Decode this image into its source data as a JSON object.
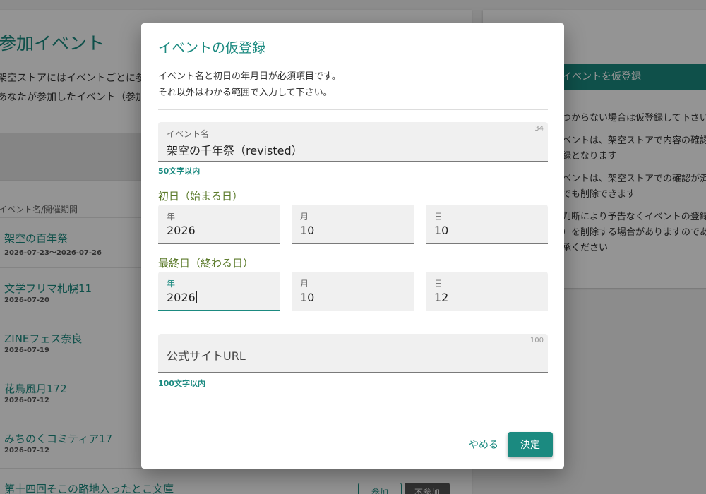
{
  "background": {
    "page_title": "参加イベント",
    "desc_line1": "架空ストアにはイベントごとに参",
    "desc_line2": "あなたが参加したイベント（参加",
    "column_header": "イベント名/開催期間",
    "events": [
      {
        "name": "架空の百年祭",
        "date": "2026-07-23～2026-07-26"
      },
      {
        "name": "文学フリマ札幌11",
        "date": "2026-07-20"
      },
      {
        "name": "ZINEフェス奈良",
        "date": "2026-07-19"
      },
      {
        "name": "花鳥風月172",
        "date": "2026-07-12"
      },
      {
        "name": "みちのくコミティア17",
        "date": "2026-07-12"
      },
      {
        "name": "第十四回そこの路地入ったとこ文庫",
        "date": ""
      }
    ],
    "row_buttons": {
      "join": "参加",
      "not_join": "不参加"
    },
    "side_button": "イベントを仮登録",
    "side_notes": [
      "つからない場合は仮登録して下さい",
      "ベントは、架空ストアで内容の確認",
      "録となります",
      "ベントは、架空ストアでの確認が済",
      "でも削除できます",
      "判断により予告なくイベントの登録",
      "）を削除する場合がありますのであ",
      "承ください"
    ]
  },
  "dialog": {
    "title": "イベントの仮登録",
    "description_line1": "イベント名と初日の年月日が必須項目です。",
    "description_line2": "それ以外はわかる範囲で入力して下さい。",
    "event_name": {
      "label": "イベント名",
      "value": "架空の千年祭（revisted）",
      "counter": "34",
      "hint": "50文字以内"
    },
    "start_section": "初日（始まる日）",
    "start": {
      "year": {
        "label": "年",
        "value": "2026"
      },
      "month": {
        "label": "月",
        "value": "10"
      },
      "day": {
        "label": "日",
        "value": "10"
      }
    },
    "end_section": "最終日（終わる日）",
    "end": {
      "year": {
        "label": "年",
        "value": "2026"
      },
      "month": {
        "label": "月",
        "value": "10"
      },
      "day": {
        "label": "日",
        "value": "12"
      }
    },
    "url": {
      "placeholder": "公式サイトURL",
      "counter": "100",
      "hint": "100文字以内"
    },
    "cancel_label": "やめる",
    "ok_label": "決定"
  },
  "colors": {
    "accent": "#1b8a80",
    "section": "#5b7a2a",
    "overlay": "rgba(0,0,0,0.42)"
  }
}
